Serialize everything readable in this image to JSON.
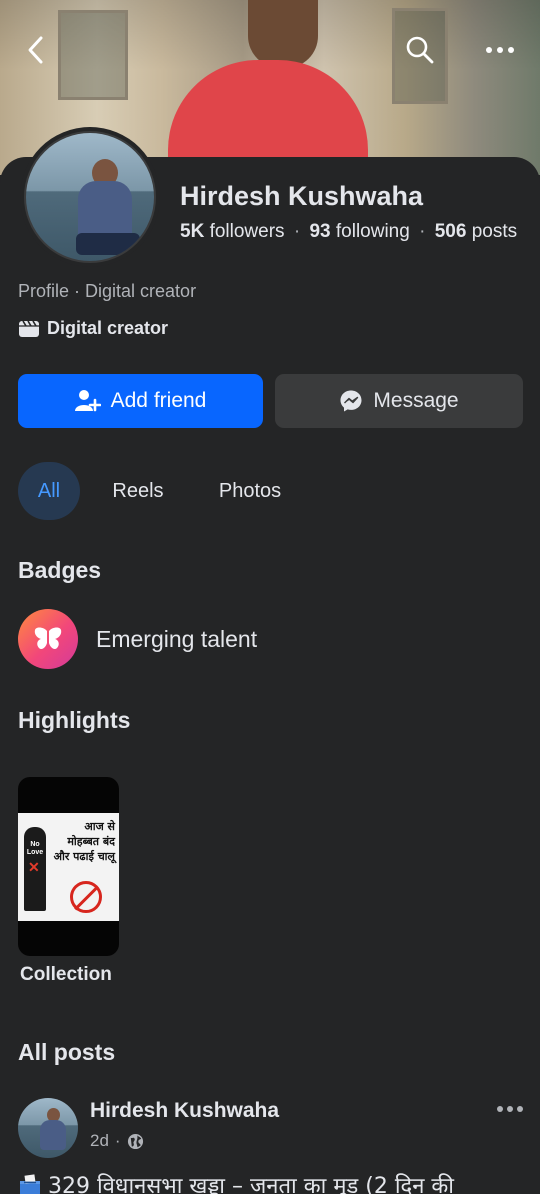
{
  "profile": {
    "name": "Hirdesh Kushwaha",
    "followers_count": "5K",
    "followers_label": "followers",
    "following_count": "93",
    "following_label": "following",
    "posts_count": "506",
    "posts_label": "posts",
    "separator": "·",
    "subtitle": "Profile · Digital creator",
    "category": "Digital creator"
  },
  "actions": {
    "add_friend": "Add friend",
    "message": "Message"
  },
  "tabs": [
    {
      "label": "All",
      "active": true
    },
    {
      "label": "Reels",
      "active": false
    },
    {
      "label": "Photos",
      "active": false
    }
  ],
  "badges": {
    "title": "Badges",
    "items": [
      {
        "label": "Emerging talent",
        "icon": "butterfly-icon"
      }
    ]
  },
  "highlights": {
    "title": "Highlights",
    "items": [
      {
        "label": "Collection",
        "thumbnail_text": "आज से मोहब्बत बंद और पढाई चालू",
        "thumbnail_badge": "No Love"
      }
    ]
  },
  "posts": {
    "title": "All posts",
    "items": [
      {
        "author": "Hirdesh Kushwaha",
        "time": "2d",
        "separator": "·",
        "privacy_icon": "globe-icon",
        "text": "329 विधानसभा खड्डा – जनता का मूड (2 दिन की"
      }
    ]
  },
  "colors": {
    "background": "#242526",
    "primary": "#0866ff",
    "secondary_button": "#3a3b3c",
    "active_tab_bg": "#263951",
    "active_tab_text": "#4599ff",
    "muted_text": "#b0b3b8"
  }
}
